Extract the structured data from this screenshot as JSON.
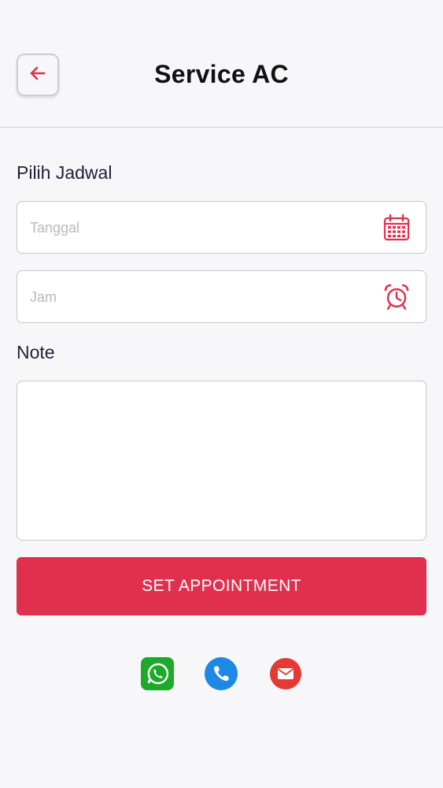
{
  "header": {
    "title": "Service AC",
    "back_icon": "arrow-left-icon"
  },
  "schedule": {
    "label": "Pilih Jadwal",
    "date_field": {
      "placeholder": "Tanggal",
      "value": "",
      "icon": "calendar-icon"
    },
    "time_field": {
      "placeholder": "Jam",
      "value": "",
      "icon": "alarm-clock-icon"
    }
  },
  "note": {
    "label": "Note",
    "value": ""
  },
  "submit": {
    "label": "SET APPOINTMENT"
  },
  "contacts": {
    "items": [
      "whatsapp-icon",
      "phone-icon",
      "email-icon"
    ]
  },
  "colors": {
    "accent": "#e1304d",
    "whatsapp": "#1fa92a",
    "phone": "#1e88e5",
    "email": "#e53935"
  }
}
